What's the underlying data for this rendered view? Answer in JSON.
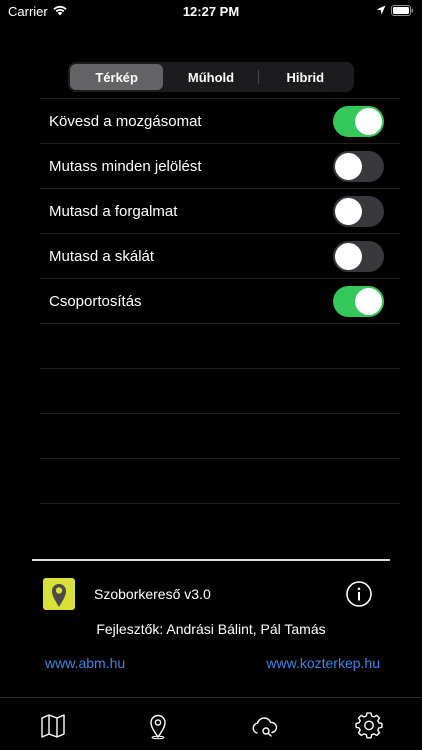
{
  "status_bar": {
    "carrier": "Carrier",
    "time": "12:27 PM"
  },
  "map_type": {
    "segments": [
      {
        "label": "Térkép",
        "selected": true
      },
      {
        "label": "Műhold",
        "selected": false
      },
      {
        "label": "Hibrid",
        "selected": false
      }
    ]
  },
  "settings": [
    {
      "label": "Kövesd a mozgásomat",
      "on": true
    },
    {
      "label": "Mutass minden jelölést",
      "on": false
    },
    {
      "label": "Mutasd a forgalmat",
      "on": false
    },
    {
      "label": "Mutasd a skálát",
      "on": false
    },
    {
      "label": "Csoportosítás",
      "on": true
    }
  ],
  "footer": {
    "app_name": "Szoborkereső v3.0",
    "developers": "Fejlesztők: Andrási Bálint, Pál Tamás",
    "link_left": "www.abm.hu",
    "link_right": "www.kozterkep.hu"
  },
  "tabs": [
    {
      "icon": "map-icon"
    },
    {
      "icon": "location-pin-icon"
    },
    {
      "icon": "cloud-search-icon"
    },
    {
      "icon": "gear-icon"
    }
  ],
  "colors": {
    "switch_on": "#34c759",
    "link": "#3a86e6",
    "logo": "#d8e03a"
  }
}
